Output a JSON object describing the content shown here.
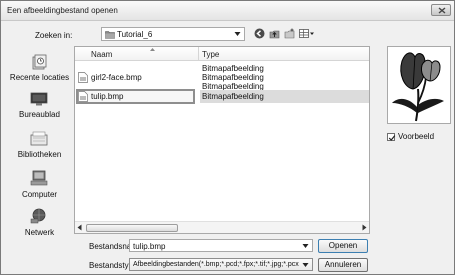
{
  "window": {
    "title": "Een afbeeldingbestand openen"
  },
  "lookin": {
    "label": "Zoeken in:",
    "value": "Tutorial_6"
  },
  "places": [
    {
      "label": "Recente locaties",
      "icon": "recent-places-icon"
    },
    {
      "label": "Bureaublad",
      "icon": "desktop-icon"
    },
    {
      "label": "Bibliotheken",
      "icon": "libraries-icon"
    },
    {
      "label": "Computer",
      "icon": "computer-icon"
    },
    {
      "label": "Netwerk",
      "icon": "network-icon"
    }
  ],
  "filelist": {
    "columns": {
      "name": "Naam",
      "type": "Type"
    },
    "rows": [
      {
        "name": "",
        "type": "Bitmapafbeelding"
      },
      {
        "name": "girl2-face.bmp",
        "type": "Bitmapafbeelding"
      },
      {
        "name": "",
        "type": "Bitmapafbeelding"
      },
      {
        "name": "tulip.bmp",
        "type": "Bitmapafbeelding"
      }
    ]
  },
  "preview": {
    "checkbox_label": "Voorbeeld",
    "checked": true
  },
  "filename": {
    "label": "Bestandsnaam:",
    "value": "tulip.bmp"
  },
  "filetype": {
    "label": "Bestandstypen:",
    "value": "Afbeeldingbestanden(*.bmp;*.pcd;*.fpx;*.tif;*.jpg;*.pcx"
  },
  "buttons": {
    "open": "Openen",
    "cancel": "Annuleren"
  },
  "colors": {
    "selection": "#dcdcdc",
    "accent": "#3c7fb1"
  }
}
